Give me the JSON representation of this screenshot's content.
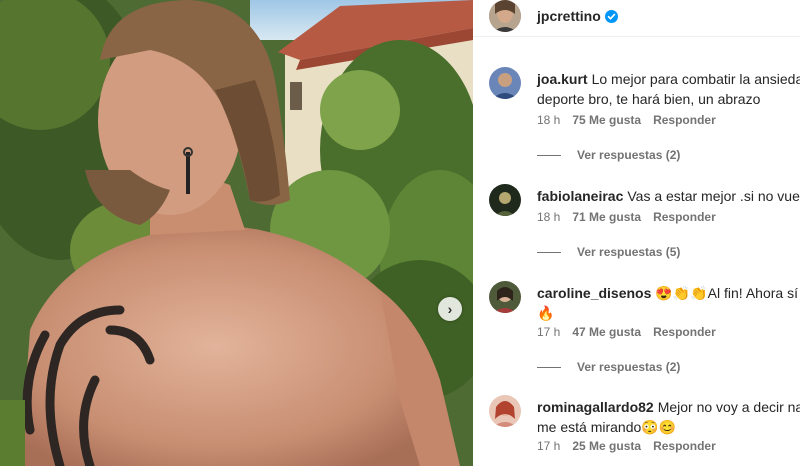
{
  "post": {
    "username": "jpcrettino",
    "verified": true
  },
  "photo": {
    "next_icon": "chevron-right-icon"
  },
  "colors": {
    "verified": "#0095f6",
    "text": "#262626",
    "secondary": "#737373"
  },
  "comments": [
    {
      "user": "joa.kurt",
      "text_line1": "Lo mejor para combatir la ansiedad",
      "text_line2": "deporte bro, te hará bien, un abrazo",
      "time": "18 h",
      "likes": "75 Me gusta",
      "reply": "Responder",
      "view_replies": "Ver respuestas (2)"
    },
    {
      "user": "fabiolaneirac",
      "text_line1": "Vas a estar mejor .si no vuelve",
      "text_line2": "",
      "time": "18 h",
      "likes": "71 Me gusta",
      "reply": "Responder",
      "view_replies": "Ver respuestas (5)"
    },
    {
      "user": "caroline_disenos",
      "text_line1": "😍👏👏Al fin! Ahora sí pa",
      "text_line2": "🔥",
      "time": "17 h",
      "likes": "47 Me gusta",
      "reply": "Responder",
      "view_replies": "Ver respuestas (2)"
    },
    {
      "user": "rominagallardo82",
      "text_line1": "Mejor no voy a decir nad",
      "text_line2": "me está mirando😳😊",
      "time": "17 h",
      "likes": "25 Me gusta",
      "reply": "Responder",
      "view_replies": ""
    }
  ]
}
